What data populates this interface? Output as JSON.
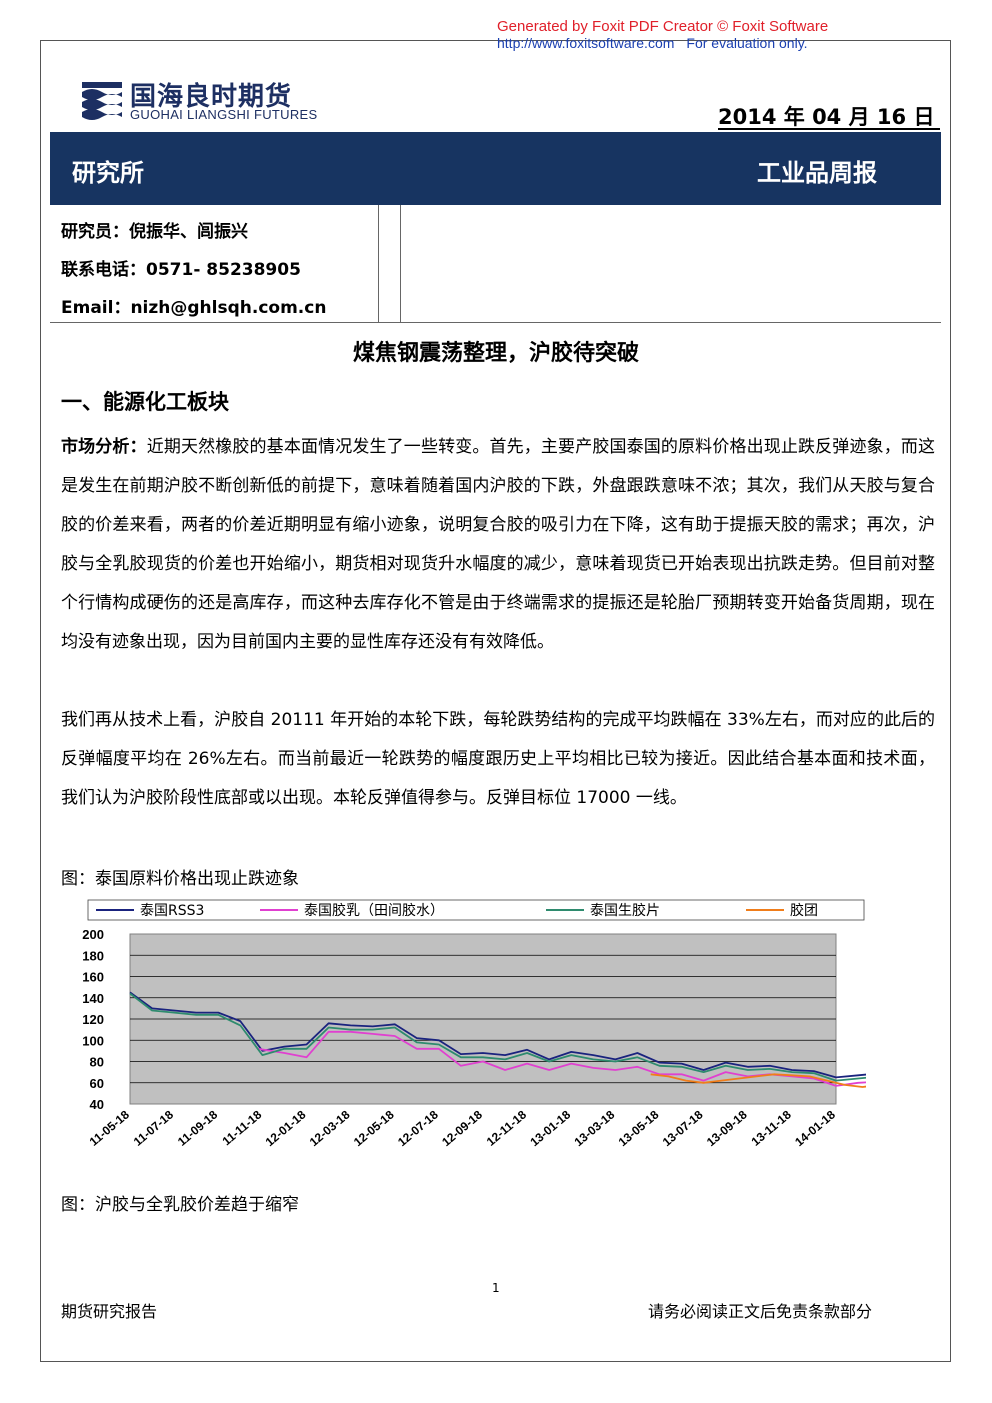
{
  "watermark": {
    "line1": "Generated by Foxit PDF Creator © Foxit Software",
    "url": "http://www.foxitsoftware.com",
    "note": "For evaluation only."
  },
  "logo": {
    "cn": "国海良时期货",
    "en": "GUOHAI LIANGSHI FUTURES"
  },
  "date": "2014 年 04 月 16 日",
  "banner": {
    "left": "研究所",
    "right": "工业品周报"
  },
  "info": {
    "researcher": "研究员：倪振华、闾振兴",
    "phone": "联系电话：0571- 85238905",
    "email": "Email：nizh@ghlsqh.com.cn"
  },
  "title": "煤焦钢震荡整理，沪胶待突破",
  "section1": "一、能源化工板块",
  "para1_label": "市场分析：",
  "para1": "近期天然橡胶的基本面情况发生了一些转变。首先，主要产胶国泰国的原料价格出现止跌反弹迹象，而这是发生在前期沪胶不断创新低的前提下，意味着随着国内沪胶的下跌，外盘跟跌意味不浓；其次，我们从天胶与复合胶的价差来看，两者的价差近期明显有缩小迹象，说明复合胶的吸引力在下降，这有助于提振天胶的需求；再次，沪胶与全乳胶现货的价差也开始缩小，期货相对现货升水幅度的减少，意味着现货已开始表现出抗跌走势。但目前对整个行情构成硬伤的还是高库存，而这种去库存化不管是由于终端需求的提振还是轮胎厂预期转变开始备货周期，现在均没有迹象出现，因为目前国内主要的显性库存还没有有效降低。",
  "para2": "我们再从技术上看，沪胶自 20111 年开始的本轮下跌，每轮跌势结构的完成平均跌幅在 33%左右，而对应的此后的反弹幅度平均在 26%左右。而当前最近一轮跌势的幅度跟历史上平均相比已较为接近。因此结合基本面和技术面，我们认为沪胶阶段性底部或以出现。本轮反弹值得参与。反弹目标位 17000 一线。",
  "fig1_caption": "图：泰国原料价格出现止跌迹象",
  "fig2_caption": "图：沪胶与全乳胶价差趋于缩窄",
  "chart_data": {
    "type": "line",
    "ylim": [
      40,
      200
    ],
    "yticks": [
      "200",
      "180",
      "160",
      "140",
      "120",
      "100",
      "80",
      "60",
      "40"
    ],
    "xticks": [
      "11-05-18",
      "11-07-18",
      "11-09-18",
      "11-11-18",
      "12-01-18",
      "12-03-18",
      "12-05-18",
      "12-07-18",
      "12-09-18",
      "12-11-18",
      "13-01-18",
      "13-03-18",
      "13-05-18",
      "13-07-18",
      "13-09-18",
      "13-11-18",
      "14-01-18"
    ],
    "series": [
      {
        "name": "泰国RSS3",
        "color": "#1a237e",
        "x": [
          0,
          0.5,
          1,
          1.5,
          2,
          2.5,
          3,
          3.5,
          4,
          4.5,
          5,
          5.5,
          6,
          6.5,
          7,
          7.5,
          8,
          8.5,
          9,
          9.5,
          10,
          10.5,
          11,
          11.5,
          12,
          12.5,
          13,
          13.5,
          14,
          14.5,
          15,
          15.5,
          16,
          16.5,
          17
        ],
        "values": [
          145,
          130,
          128,
          126,
          126,
          118,
          90,
          94,
          96,
          116,
          114,
          113,
          115,
          102,
          100,
          87,
          88,
          86,
          91,
          82,
          89,
          86,
          82,
          88,
          79,
          78,
          72,
          79,
          75,
          76,
          72,
          71,
          65,
          67,
          69
        ]
      },
      {
        "name": "泰国胶乳（田间胶水）",
        "color": "#e040d0",
        "x": [
          2.9,
          3.5,
          4,
          4.5,
          5,
          5.5,
          6,
          6.5,
          7,
          7.5,
          8,
          8.5,
          9,
          9.5,
          10,
          10.5,
          11,
          11.5,
          12,
          12.5,
          13,
          13.5,
          14,
          14.5,
          15,
          15.5,
          16,
          16.5,
          17
        ],
        "values": [
          92,
          88,
          84,
          108,
          108,
          106,
          104,
          92,
          92,
          76,
          80,
          72,
          78,
          72,
          78,
          74,
          72,
          75,
          68,
          68,
          62,
          70,
          66,
          68,
          66,
          64,
          57,
          60,
          61
        ]
      },
      {
        "name": "泰国生胶片",
        "color": "#2e8b6e",
        "x": [
          0,
          0.5,
          1,
          1.5,
          2,
          2.5,
          3,
          3.5,
          4,
          4.5,
          5,
          5.5,
          6,
          6.5,
          7,
          7.5,
          8,
          8.5,
          9,
          9.5,
          10,
          10.5,
          11,
          11.5,
          12,
          12.5,
          13,
          13.5,
          14,
          14.5,
          15,
          15.5,
          16,
          16.5,
          17
        ],
        "values": [
          144,
          128,
          126,
          124,
          124,
          114,
          86,
          92,
          92,
          112,
          110,
          110,
          112,
          98,
          96,
          84,
          84,
          82,
          88,
          80,
          86,
          82,
          80,
          84,
          76,
          75,
          70,
          76,
          72,
          73,
          70,
          69,
          62,
          64,
          66
        ]
      },
      {
        "name": "胶团",
        "color": "#f07d1a",
        "x": [
          11.8,
          12.2,
          12.6,
          13,
          13.4,
          13.8,
          14.2,
          14.6,
          15,
          15.4,
          15.8,
          16.2,
          16.6,
          17
        ],
        "values": [
          68,
          66,
          62,
          60,
          62,
          64,
          66,
          68,
          67,
          66,
          62,
          58,
          56,
          58
        ]
      }
    ]
  },
  "footer": {
    "left": "期货研究报告",
    "right": "请务必阅读正文后免责条款部分",
    "page": "1"
  }
}
